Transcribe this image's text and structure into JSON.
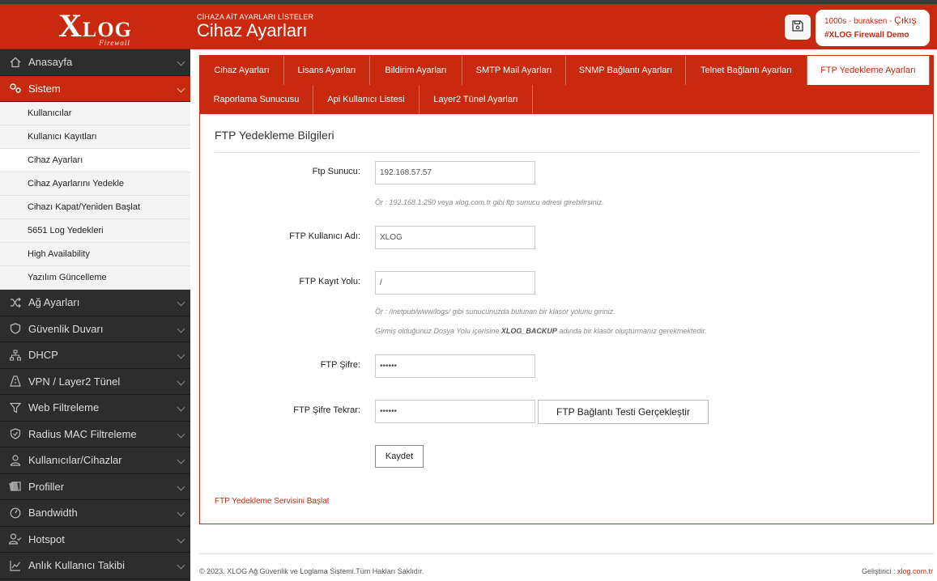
{
  "brand": {
    "logo_x": "X",
    "logo_log": "LOG",
    "logo_sub": "Firewall"
  },
  "header": {
    "breadcrumb": "CİHAZA AİT AYARLARI LİSTELER",
    "title": "Cihaz Ayarları",
    "user_text": "1000s - buraksen",
    "user_sep": " - ",
    "exit_label": "Çıkış",
    "site_name": "#XLOG Firewall Demo"
  },
  "sidebar": {
    "items": [
      {
        "label": "Anasayfa",
        "icon": "home-icon"
      },
      {
        "label": "Sistem",
        "icon": "gears-icon",
        "active": true
      },
      {
        "label": "Ağ Ayarları",
        "icon": "shuffle-icon"
      },
      {
        "label": "Güvenlik Duvarı",
        "icon": "shield-icon"
      },
      {
        "label": "DHCP",
        "icon": "sitemap-icon"
      },
      {
        "label": "VPN / Layer2 Tünel",
        "icon": "vpn-icon"
      },
      {
        "label": "Web Filtreleme",
        "icon": "filter-icon"
      },
      {
        "label": "Radius MAC Filtreleme",
        "icon": "shield-check-icon"
      },
      {
        "label": "Kullanıcılar/Cihazlar",
        "icon": "user-icon"
      },
      {
        "label": "Profiller",
        "icon": "profiles-icon"
      },
      {
        "label": "Bandwidth",
        "icon": "gauge-icon"
      },
      {
        "label": "Hotspot",
        "icon": "user-check-icon"
      },
      {
        "label": "Anlık Kullanıcı Takibi",
        "icon": "chart-line-icon"
      }
    ],
    "sub_items": [
      {
        "label": "Kullanıcılar"
      },
      {
        "label": "Kullanıcı Kayıtları"
      },
      {
        "label": "Cihaz Ayarları",
        "active": true
      },
      {
        "label": "Cihaz Ayarlarını Yedekle"
      },
      {
        "label": "Cihazı Kapat/Yeniden Başlat"
      },
      {
        "label": "5651 Log Yedekleri"
      },
      {
        "label": "High Availability"
      },
      {
        "label": "Yazılım Güncelleme"
      }
    ]
  },
  "tabs": [
    {
      "label": "Cihaz Ayarları"
    },
    {
      "label": "Lisans Ayarları"
    },
    {
      "label": "Bildirim Ayarları"
    },
    {
      "label": "SMTP Mail Ayarları"
    },
    {
      "label": "SNMP Bağlantı Ayarları"
    },
    {
      "label": "Telnet Bağlantı Ayarları"
    },
    {
      "label": "FTP Yedekleme Ayarları",
      "active": true
    },
    {
      "label": "Raporlama Sunucusu"
    },
    {
      "label": "Api Kullanıcı Listesi"
    },
    {
      "label": "Layer2 Tünel Ayarları"
    }
  ],
  "form": {
    "title": "FTP Yedekleme Bilgileri",
    "ftp_server_label": "Ftp Sunucu:",
    "ftp_server_value": "192.168.57.57",
    "ftp_server_hint": "Ör : 192.168.1.250 veya xlog.com.tr gibi ftp sunucu adresi girebilirsiniz.",
    "ftp_user_label": "FTP Kullanıcı Adı:",
    "ftp_user_value": "XLOG",
    "ftp_path_label": "FTP Kayıt Yolu:",
    "ftp_path_value": "/",
    "ftp_path_hint1": "Ör : /inetpub/www/logs/ gibi sunucunuzda bulunan bir klasor yolunu giriniz.",
    "ftp_path_hint2_pre": "Girmiş olduğunuz Dosya Yolu içerisine ",
    "ftp_path_hint2_bold": "XLOG_BACKUP",
    "ftp_path_hint2_post": " adında bir klasör oluşturmanız gerekmektedir.",
    "ftp_password_label": "FTP Şifre:",
    "ftp_password_value": "••••••",
    "ftp_password_repeat_label": "FTP Şifre Tekrar:",
    "ftp_password_repeat_value": "••••••",
    "test_button": "FTP Bağlantı Testi Gerçekleştir",
    "save_button": "Kaydet",
    "start_service_link": "FTP Yedekleme Servisini Başlat"
  },
  "footer": {
    "copyright": "© 2023. XLOG Ağ Güvenlik ve Loglama Sistemi.Tüm Hakları Saklıdır.",
    "developer_label": "Geliştirici : ",
    "developer_link": "xlog.com.tr"
  },
  "colors": {
    "brand": "#c8290f",
    "sidebar_bg": "#2d2d2d",
    "submenu_bg": "#f3f3f3"
  }
}
